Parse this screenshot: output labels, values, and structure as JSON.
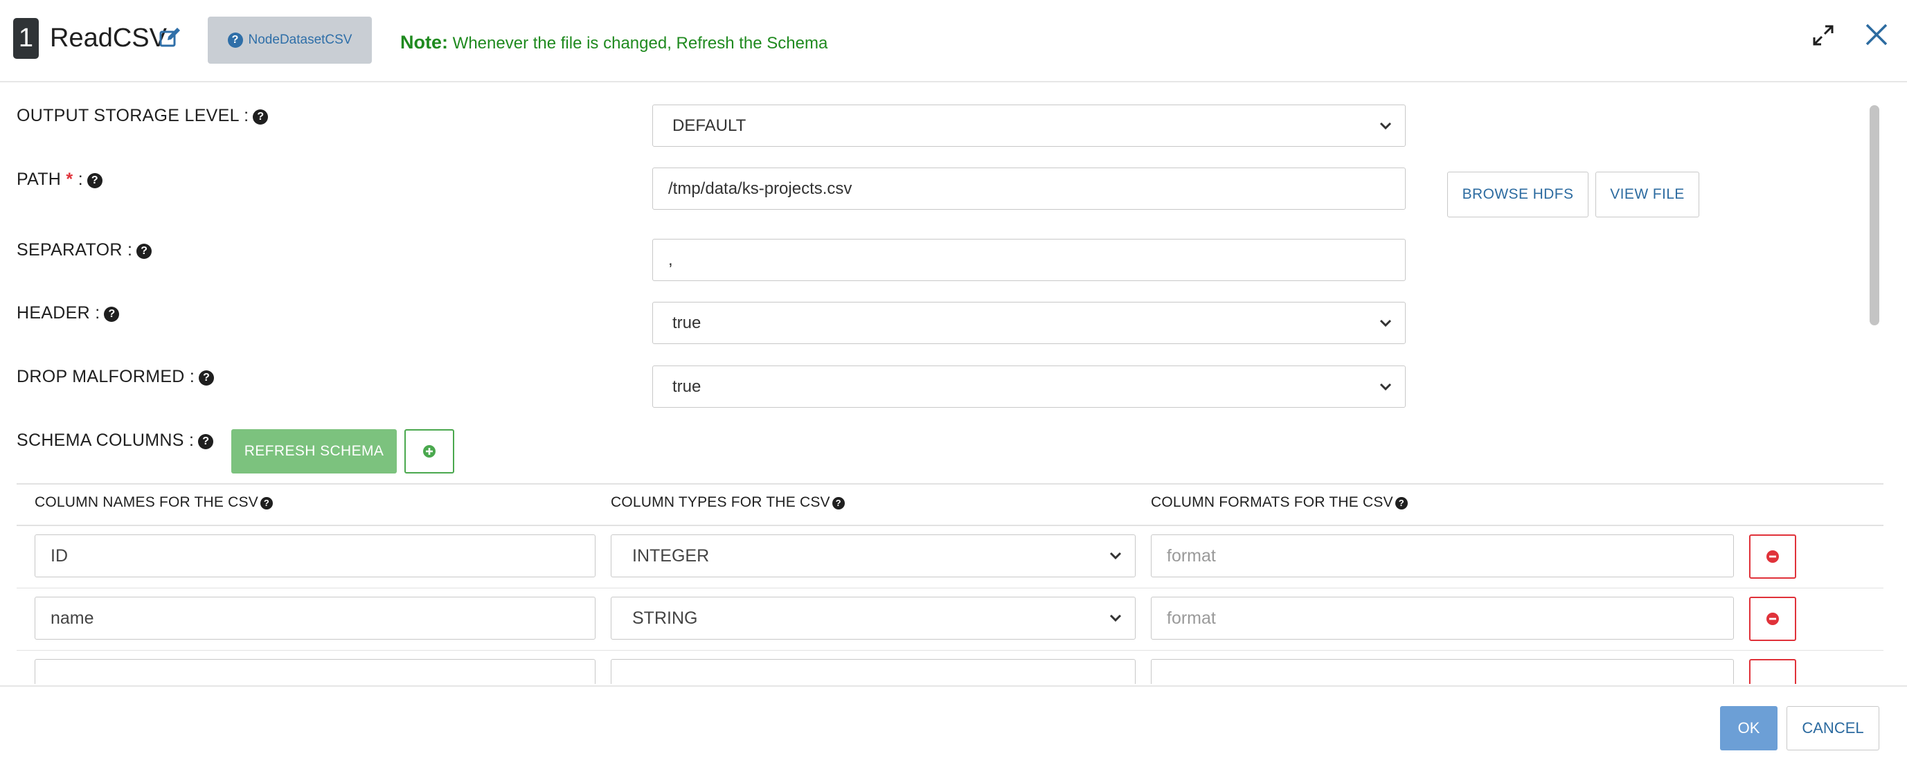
{
  "header": {
    "step_number": "1",
    "title": "ReadCSV",
    "node_button_label": "NodeDatasetCSV",
    "note_label": "Note:",
    "note_text": "Whenever the file is changed, Refresh the Schema"
  },
  "form": {
    "output_storage_level": {
      "label": "OUTPUT STORAGE LEVEL :",
      "value": "DEFAULT"
    },
    "path": {
      "label": "PATH",
      "required_mark": "*",
      "colon": ":",
      "value": "/tmp/data/ks-projects.csv"
    },
    "separator": {
      "label": "SEPARATOR :",
      "value": ","
    },
    "header": {
      "label": "HEADER :",
      "value": "true"
    },
    "drop_malformed": {
      "label": "DROP MALFORMED :",
      "value": "true"
    },
    "schema_columns": {
      "label": "SCHEMA COLUMNS :"
    }
  },
  "buttons": {
    "browse_hdfs": "BROWSE HDFS",
    "view_file": "VIEW FILE",
    "refresh_schema": "REFRESH SCHEMA",
    "ok": "OK",
    "cancel": "CANCEL"
  },
  "table": {
    "headers": [
      "COLUMN NAMES FOR THE CSV",
      "COLUMN TYPES FOR THE CSV",
      "COLUMN FORMATS FOR THE CSV"
    ],
    "rows": [
      {
        "name": "ID",
        "type": "INTEGER",
        "format_placeholder": "format"
      },
      {
        "name": "name",
        "type": "STRING",
        "format_placeholder": "format"
      }
    ]
  },
  "icons": {
    "edit": "edit-icon",
    "help": "question-circle-icon",
    "expand": "expand-icon",
    "close": "close-icon",
    "add": "plus-circle-icon",
    "remove": "minus-circle-icon",
    "dropdown": "chevron-down-icon"
  },
  "colors": {
    "note_green": "#1f8a1f",
    "primary_blue": "#2c6ba0",
    "refresh_green": "#7cc27e",
    "danger_red": "#e0323a",
    "ok_blue": "#6c9fd6"
  }
}
